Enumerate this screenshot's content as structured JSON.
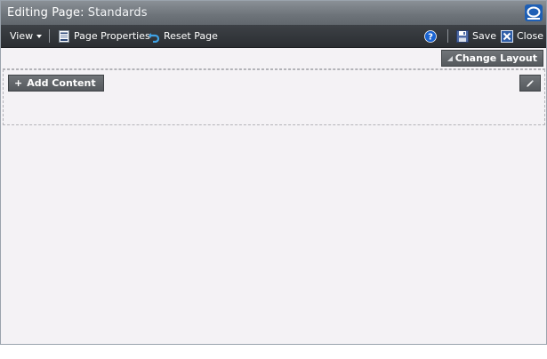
{
  "titlebar": {
    "prefix": "Editing Page:",
    "page_name": "Standards",
    "logo_icon": "oracle-o-icon"
  },
  "toolbar": {
    "view_label": "View",
    "page_properties_label": "Page Properties",
    "reset_page_label": "Reset Page",
    "save_label": "Save",
    "close_label": "Close",
    "help_icon": "help-icon"
  },
  "layout": {
    "change_layout_label": "Change Layout",
    "add_content_label": "Add Content"
  },
  "colors": {
    "titlebar": "#6d7379",
    "toolbar": "#2b2e32",
    "canvas": "#f4f2f5",
    "help_blue": "#1b64d1"
  }
}
